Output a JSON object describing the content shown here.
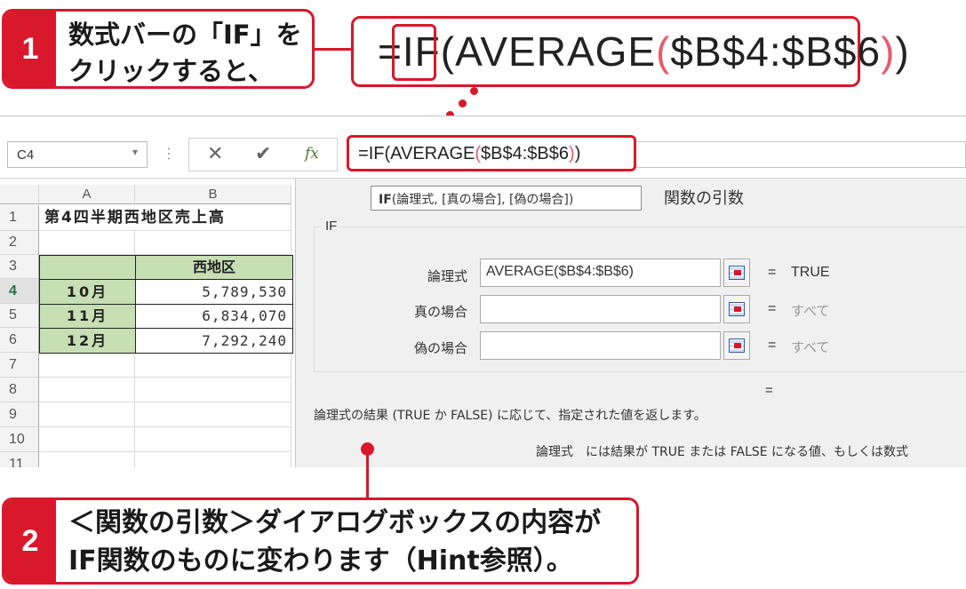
{
  "callout1": {
    "number": "1",
    "text": "数式バーの「IF」を\nクリックすると、"
  },
  "callout2": {
    "number": "2",
    "text": "＜関数の引数＞ダイアログボックスの内容が\nIF関数のものに変わります（Hint参照）。"
  },
  "zoomed_formula": {
    "prefix": "=",
    "func": "IF",
    "open_paren": "(",
    "inner": "AVERAGE",
    "inner_open": "(",
    "range": "$B$4:$B$6",
    "inner_close": ")",
    "close_paren": ")"
  },
  "formula_bar": {
    "name_box": "C4",
    "name_box_arrow": "▾",
    "separator": "⋮",
    "cancel_glyph": "✕",
    "enter_glyph": "✔",
    "fx_label": "fx",
    "formula": {
      "prefix": "=",
      "func": "IF",
      "open_paren": "(",
      "inner": "AVERAGE",
      "inner_open": "(",
      "range": "$B$4:$B$6",
      "inner_close": ")",
      "close_paren": ")"
    }
  },
  "sheet": {
    "columns": [
      "A",
      "B"
    ],
    "rows": [
      "1",
      "2",
      "3",
      "4",
      "5",
      "6",
      "7",
      "8",
      "9",
      "10",
      "11"
    ],
    "active_row": "4",
    "title": "第4四半期西地区売上高",
    "header_b": "西地区",
    "data": [
      {
        "month": "10月",
        "value": "5,789,530"
      },
      {
        "month": "11月",
        "value": "6,834,070"
      },
      {
        "month": "12月",
        "value": "7,292,240"
      }
    ]
  },
  "dialog": {
    "tooltip_fn": "IF",
    "tooltip_args": "(論理式, [真の場合], [偽の場合])",
    "title": "関数の引数",
    "function_name": "IF",
    "args": [
      {
        "label": "論理式",
        "value": "AVERAGE($B$4:$B$6)",
        "eq": "=",
        "result": "TRUE"
      },
      {
        "label": "真の場合",
        "value": "",
        "eq": "=",
        "result": "すべて"
      },
      {
        "label": "偽の場合",
        "value": "",
        "eq": "=",
        "result": "すべて"
      }
    ],
    "overall_eq": "=",
    "description": "論理式の結果 (TRUE か FALSE) に応じて、指定された値を返します。",
    "arg_desc_name": "論理式",
    "arg_desc_text": "には結果が TRUE または FALSE になる値、もしくは数式"
  },
  "colors": {
    "accent_red": "#d9182b",
    "header_green": "#c6e0b4",
    "active_row_green": "#217346"
  }
}
